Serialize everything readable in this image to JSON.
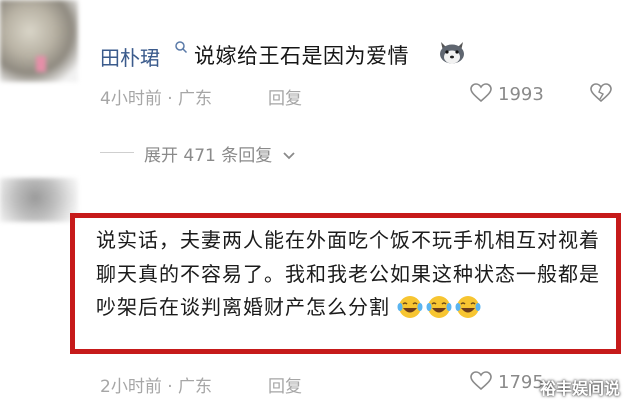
{
  "comments": [
    {
      "username": "田朴珺",
      "badge_icon": "search-icon",
      "text": "说嫁给王石是因为爱情",
      "emoji": "husky-dog-emoji",
      "time": "4小时前 · 广东",
      "reply_label": "回复",
      "like_count": "1993",
      "replies_label": "展开 471 条回复"
    },
    {
      "text": "说实话，夫妻两人能在外面吃个饭不玩手机相互对视着聊天真的不容易了。我和我老公如果这种状态一般都是吵架后在谈判离婚财产怎么分割",
      "emoji": "tears-of-joy-emoji",
      "emoji_count": 3,
      "time": "2小时前 · 广东",
      "reply_label": "回复",
      "like_count": "1795"
    }
  ],
  "highlight_color": "#c61a1a",
  "watermark": "裕丰娱间说"
}
